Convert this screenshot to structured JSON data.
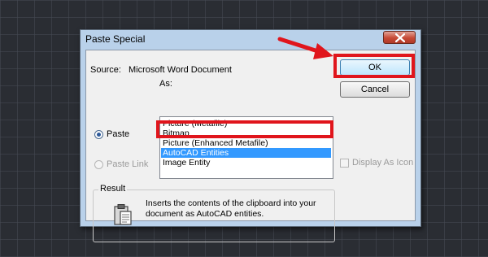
{
  "dialog": {
    "title": "Paste Special",
    "close_icon": "close-icon",
    "source_label": "Source:",
    "source_value": "Microsoft Word Document",
    "as_label": "As:",
    "paste_option": "Paste",
    "paste_link_option": "Paste Link",
    "paste_selected": true,
    "ok_label": "OK",
    "cancel_label": "Cancel",
    "list_items": [
      {
        "label": "Picture (Metafile)",
        "selected": false
      },
      {
        "label": "Bitmap",
        "selected": false
      },
      {
        "label": "Picture (Enhanced Metafile)",
        "selected": false
      },
      {
        "label": "AutoCAD Entities",
        "selected": true
      },
      {
        "label": "Image Entity",
        "selected": false
      }
    ],
    "display_as_icon_label": "Display As Icon",
    "display_as_icon_checked": false,
    "result_title": "Result",
    "result_icon": "clipboard-icon",
    "result_text": "Inserts the contents of the clipboard into your document as AutoCAD entities."
  },
  "annotations": {
    "highlight_color": "#e0151c",
    "arrow_icon": "red-arrow-icon"
  }
}
